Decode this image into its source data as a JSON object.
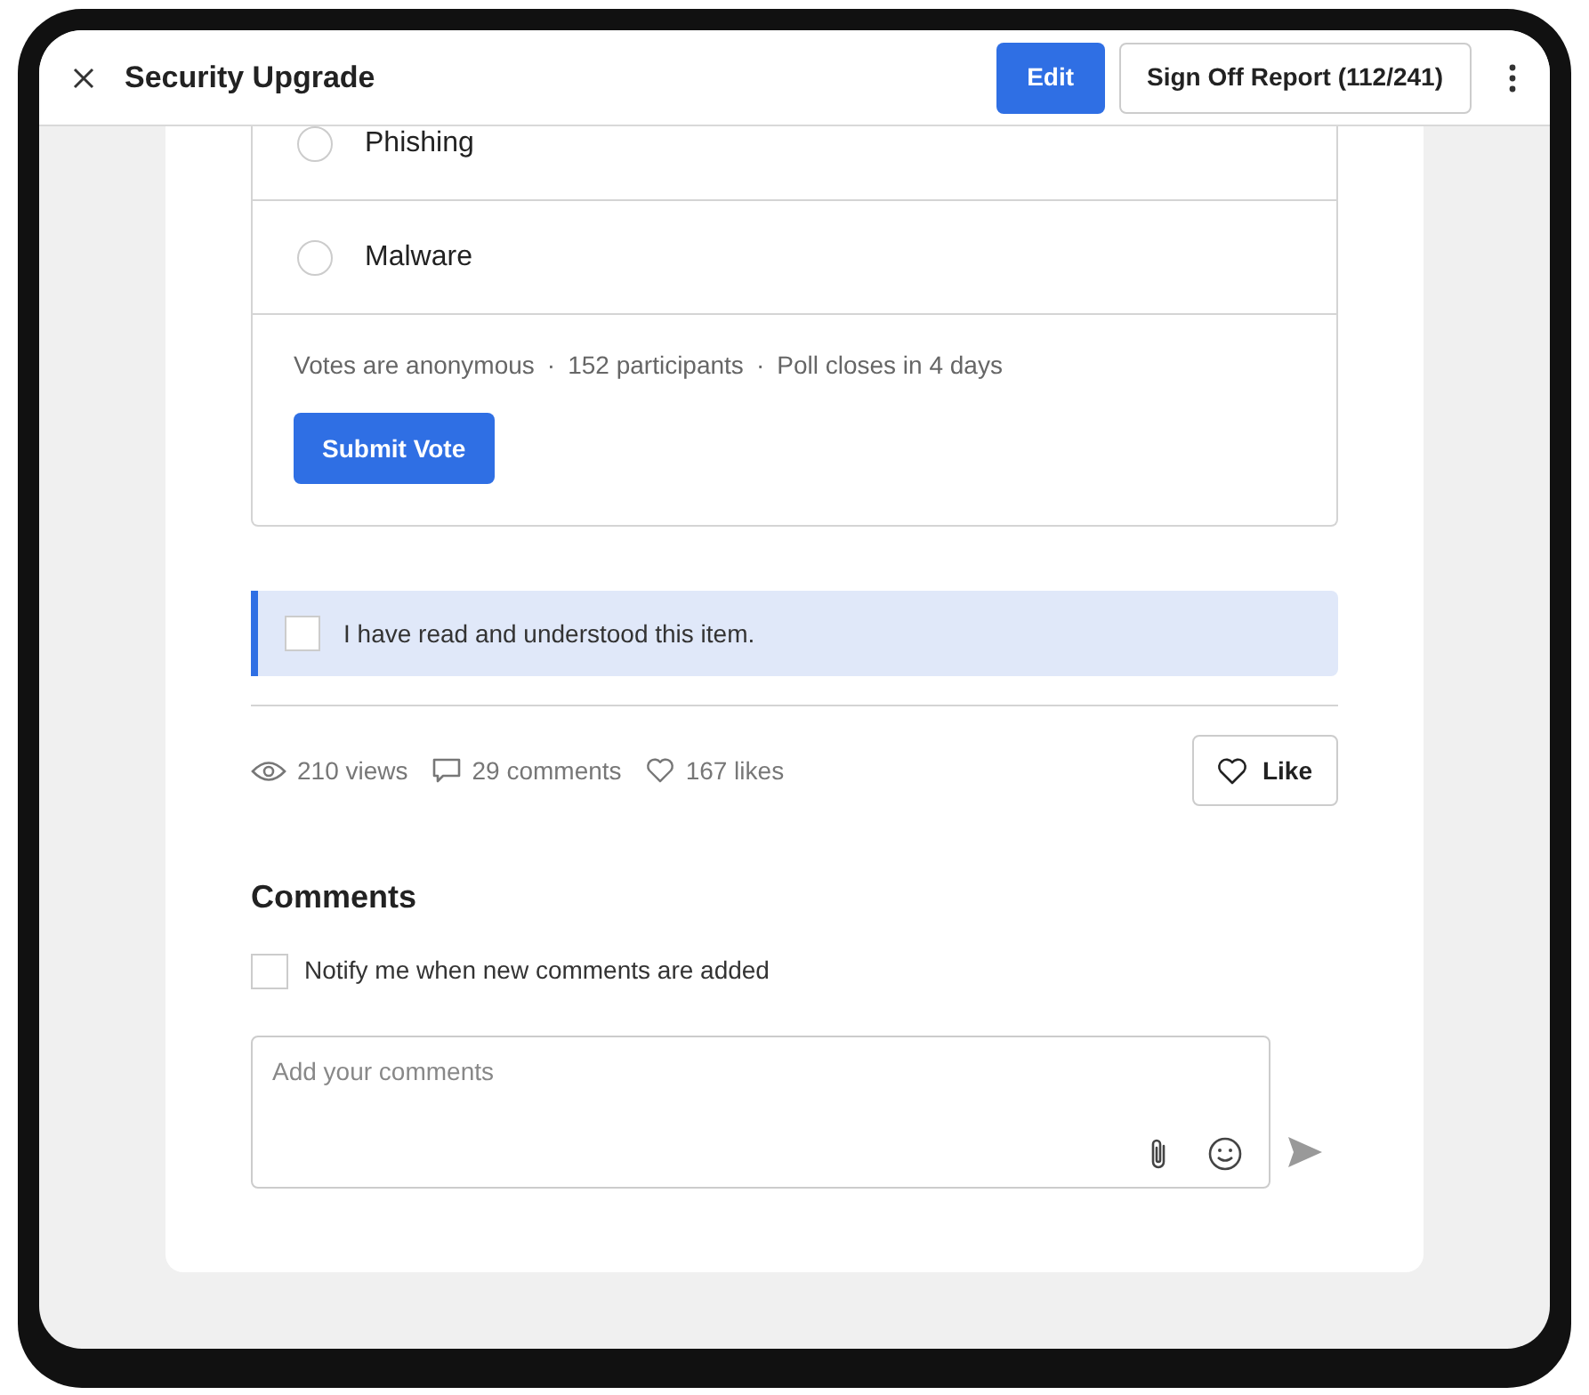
{
  "window": {
    "title": "Security Upgrade"
  },
  "header_buttons": [
    {
      "label": "Edit",
      "kind": "primary"
    },
    {
      "label": "Sign Off Report (112/241)",
      "kind": "outline"
    }
  ],
  "poll": {
    "options": [
      {
        "label": "Phishing",
        "selected": false
      },
      {
        "label": "Malware",
        "selected": false
      }
    ],
    "meta": [
      "Votes are anonymous",
      "152 participants",
      "Poll closes in 4 days"
    ],
    "separator": "·",
    "submit": "Submit Vote"
  },
  "acknowledgement": {
    "label": "I have read and understood this item.",
    "checked": false
  },
  "stats": [
    {
      "kind": "views",
      "text": "210 views"
    },
    {
      "kind": "comments",
      "text": "29 comments"
    },
    {
      "kind": "likes",
      "text": "167 likes"
    }
  ],
  "like_button": "Like",
  "comments": {
    "title": "Comments",
    "notify": {
      "label": "Notify me when new comments are added",
      "checked": false
    },
    "input": {
      "placeholder": "Add your comments"
    }
  }
}
